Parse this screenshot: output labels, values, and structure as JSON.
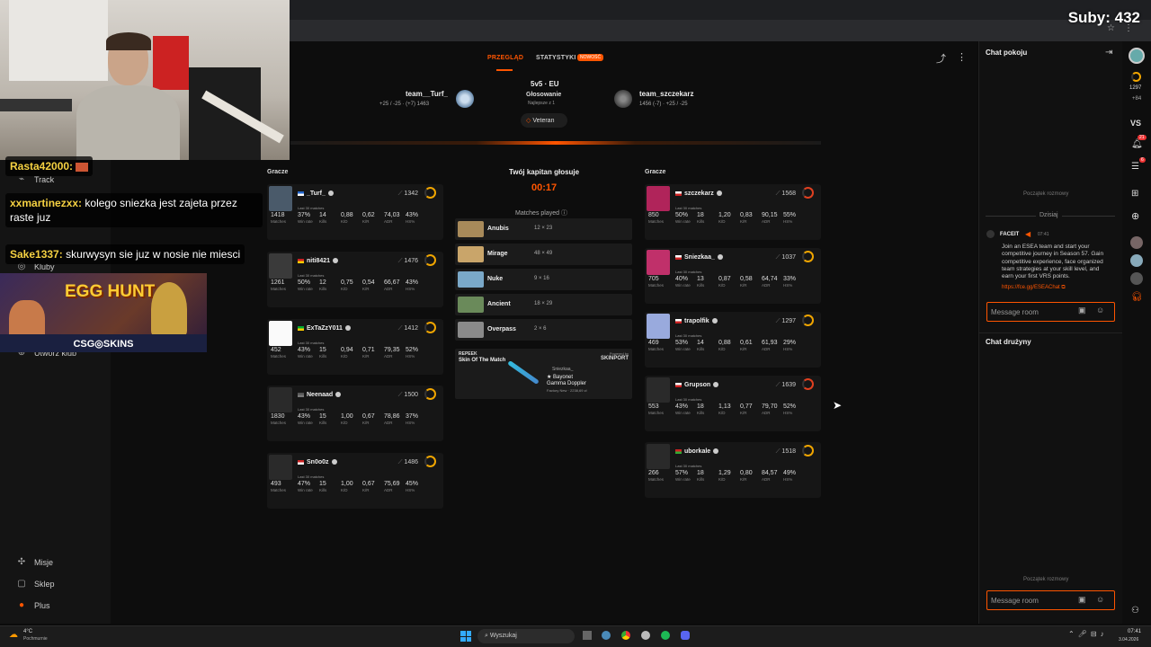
{
  "overlay": {
    "subs": "Suby: 432",
    "chat": [
      {
        "user": "Rasta42000:",
        "text": ""
      },
      {
        "user": "xxmartinezxx:",
        "text": "kolego sniezka jest zajeta przez raste juz"
      },
      {
        "user": "Sake1337:",
        "text": "skurwysyn sie juz w nosie nie miesci"
      }
    ],
    "banner_title": "EGG HUNT",
    "banner_sub": "CSG◎SKINS"
  },
  "leftnav": {
    "items_top": [
      "Track",
      "Kluby",
      "Utwórz klub"
    ],
    "items_bottom": [
      "Misje",
      "Sklep",
      "Plus"
    ]
  },
  "tabs": {
    "overview": "PRZEGLĄD",
    "stats": "STATYSTYKI",
    "new_badge": "NOWOŚĆ"
  },
  "match": {
    "mode": "5v5 · EU",
    "status": "Głosowanie",
    "best_of": "Najlepsze z 1",
    "tag": "Veteran",
    "team1": {
      "name": "team__Turf_",
      "sub": "+25 / -25 · (+7) 1463"
    },
    "team2": {
      "name": "team_szczekarz",
      "sub": "1456 (-7) · +25 / -25"
    }
  },
  "players_label": "Gracze",
  "last_label": "Last 30 matches",
  "stat_labels": [
    "Matches",
    "Win rate",
    "Kills",
    "K/D",
    "K/R",
    "ADR",
    "HS%"
  ],
  "team1_players": [
    {
      "nick": "_Turf_",
      "elo": "1342",
      "stats": [
        "1418",
        "37%",
        "14",
        "0,88",
        "0,62",
        "74,03",
        "43%"
      ]
    },
    {
      "nick": "niti8421",
      "elo": "1476",
      "stats": [
        "1261",
        "50%",
        "12",
        "0,75",
        "0,54",
        "66,67",
        "43%"
      ]
    },
    {
      "nick": "ExTaZzY011",
      "elo": "1412",
      "stats": [
        "452",
        "43%",
        "15",
        "0,94",
        "0,71",
        "79,35",
        "52%"
      ]
    },
    {
      "nick": "Neenaad",
      "elo": "1500",
      "stats": [
        "1830",
        "43%",
        "15",
        "1,00",
        "0,67",
        "78,86",
        "37%"
      ]
    },
    {
      "nick": "Sn0o0z",
      "elo": "1486",
      "stats": [
        "493",
        "47%",
        "15",
        "1,00",
        "0,67",
        "75,69",
        "45%"
      ]
    }
  ],
  "team2_players": [
    {
      "nick": "szczekarz",
      "elo": "1568",
      "stats": [
        "850",
        "50%",
        "18",
        "1,20",
        "0,83",
        "90,15",
        "55%"
      ]
    },
    {
      "nick": "Sniezkaa_",
      "elo": "1037",
      "stats": [
        "705",
        "40%",
        "13",
        "0,87",
        "0,58",
        "64,74",
        "33%"
      ]
    },
    {
      "nick": "trapolfik",
      "elo": "1297",
      "stats": [
        "469",
        "53%",
        "14",
        "0,88",
        "0,61",
        "61,93",
        "29%"
      ]
    },
    {
      "nick": "Grupson",
      "elo": "1639",
      "stats": [
        "553",
        "43%",
        "18",
        "1,13",
        "0,77",
        "79,70",
        "52%"
      ]
    },
    {
      "nick": "uborkale",
      "elo": "1518",
      "stats": [
        "266",
        "57%",
        "18",
        "1,29",
        "0,80",
        "84,57",
        "49%"
      ]
    }
  ],
  "captain": {
    "title": "Twój kapitan głosuje",
    "timer": "00:17",
    "matches_played": "Matches played"
  },
  "maps": [
    {
      "name": "Anubis",
      "vote": "12 × 23",
      "color": "#a88a5a"
    },
    {
      "name": "Mirage",
      "vote": "48 × 49",
      "color": "#c9a56a"
    },
    {
      "name": "Nuke",
      "vote": "9 × 16",
      "color": "#7aa8c8"
    },
    {
      "name": "Ancient",
      "vote": "18 × 29",
      "color": "#6a8a5a"
    },
    {
      "name": "Overpass",
      "vote": "2 × 6",
      "color": "#8a8a8a"
    }
  ],
  "skin": {
    "brand": "REPEEK",
    "title": "Skin Of The Match",
    "powered": "Powered by",
    "sponsor": "SKINPORT",
    "owner": "Sniezkaa_",
    "item1": "★ Bayonet",
    "item2": "Gamma Doppler",
    "price": "Factory New · 2238,69 zł"
  },
  "chat_room": {
    "title": "Chat pokoju",
    "start": "Początek rozmowy",
    "today": "Dzisiaj",
    "sender": "FACEIT",
    "time": "07:41",
    "message": "Join an ESEA team and start your competitive journey in Season 57. Gain competitive experience, face organized team strategies at your skill level, and earn your first VRS points.",
    "link": "https://fce.gg/ESEAChat",
    "placeholder": "Message room"
  },
  "team_chat": {
    "title": "Chat drużyny",
    "start": "Początek rozmowy",
    "placeholder": "Message room"
  },
  "rail": {
    "elo": "1297",
    "delta": "+84",
    "vs": "VS",
    "notif1": "21",
    "notif2": "6"
  },
  "taskbar": {
    "weather_temp": "4°C",
    "weather_desc": "Pochmurnie",
    "search": "Wyszukaj",
    "time": "07:41",
    "date": "3.04.2026"
  }
}
